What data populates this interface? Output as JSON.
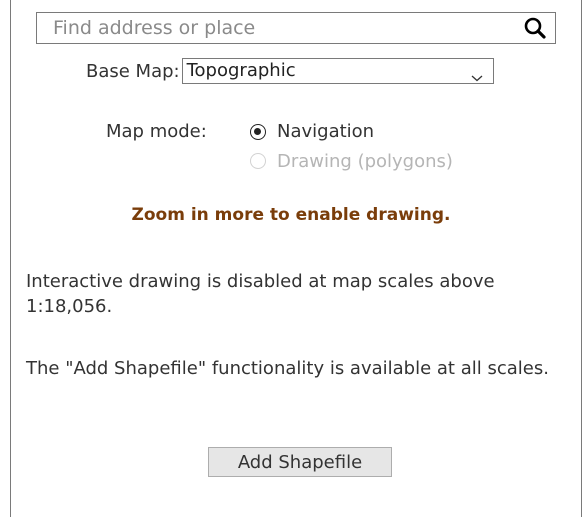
{
  "search": {
    "placeholder": "Find address or place",
    "icon": "search-icon"
  },
  "basemap": {
    "label": "Base Map:",
    "selected": "Topographic",
    "icon": "chevron-down-icon"
  },
  "map_mode": {
    "label": "Map mode:",
    "options": [
      {
        "label": "Navigation",
        "checked": true,
        "enabled": true
      },
      {
        "label": "Drawing (polygons)",
        "checked": false,
        "enabled": false
      }
    ]
  },
  "messages": {
    "zoom_warning": "Zoom in more to enable drawing.",
    "drawing_disabled": "Interactive drawing is disabled at map scales above 1:18,056.",
    "shapefile_info": "The \"Add Shapefile\" functionality is available at all scales."
  },
  "actions": {
    "add_shapefile_label": "Add Shapefile"
  },
  "colors": {
    "warning_text": "#7a3d0a",
    "disabled_text": "#b5b5b5",
    "button_bg": "#e6e6e6"
  }
}
